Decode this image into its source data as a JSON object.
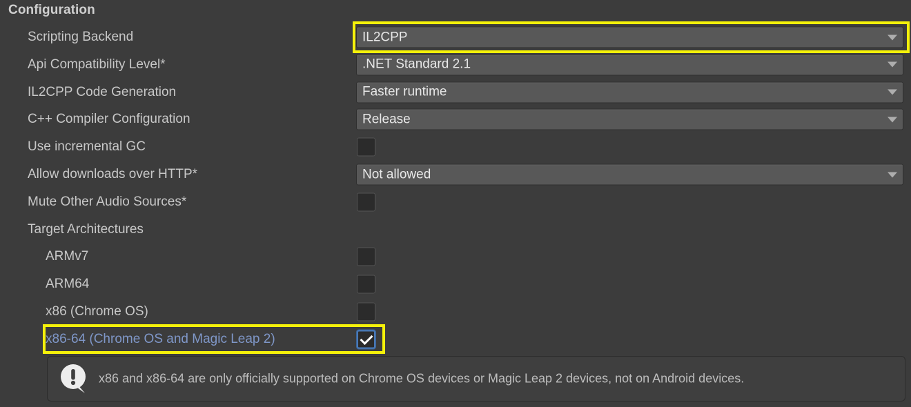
{
  "section": {
    "title": "Configuration"
  },
  "rows": [
    {
      "id": "scripting-backend",
      "label": "Scripting Backend",
      "control": "dropdown",
      "value": "IL2CPP",
      "highlighted": true
    },
    {
      "id": "api-compatibility-level",
      "label": "Api Compatibility Level*",
      "control": "dropdown",
      "value": ".NET Standard 2.1",
      "highlighted": false
    },
    {
      "id": "il2cpp-code-generation",
      "label": "IL2CPP Code Generation",
      "control": "dropdown",
      "value": "Faster runtime",
      "highlighted": false
    },
    {
      "id": "cpp-compiler-configuration",
      "label": "C++ Compiler Configuration",
      "control": "dropdown",
      "value": "Release",
      "highlighted": false
    },
    {
      "id": "use-incremental-gc",
      "label": "Use incremental GC",
      "control": "checkbox",
      "checked": false,
      "highlighted": false
    },
    {
      "id": "allow-downloads-over-http",
      "label": "Allow downloads over HTTP*",
      "control": "dropdown",
      "value": "Not allowed",
      "highlighted": false
    },
    {
      "id": "mute-other-audio-sources",
      "label": "Mute Other Audio Sources*",
      "control": "checkbox",
      "checked": false,
      "highlighted": false
    },
    {
      "id": "target-architectures",
      "label": "Target Architectures",
      "control": "none",
      "highlighted": false
    },
    {
      "id": "armv7",
      "label": "ARMv7",
      "control": "checkbox",
      "checked": false,
      "indent": 2,
      "highlighted": false
    },
    {
      "id": "arm64",
      "label": "ARM64",
      "control": "checkbox",
      "checked": false,
      "indent": 2,
      "highlighted": false
    },
    {
      "id": "x86-chrome-os",
      "label": "x86 (Chrome OS)",
      "control": "checkbox",
      "checked": false,
      "indent": 2,
      "highlighted": false
    },
    {
      "id": "x86-64-chrome-os-and-magic-leap-2",
      "label": "x86-64 (Chrome OS and Magic Leap 2)",
      "control": "checkbox",
      "checked": true,
      "indent": 2,
      "selected": true,
      "highlighted": true
    }
  ],
  "info": {
    "icon": "info-bubble-icon",
    "message": "x86 and x86-64 are only officially supported on Chrome OS devices or Magic Leap 2 devices, not on Android devices."
  },
  "colors": {
    "background": "#3c3c3c",
    "label": "#c8c8c8",
    "selected_label": "#7f97c8",
    "dropdown_background": "#585858",
    "highlight": "#f5f10a",
    "checkbox_accent": "#4a7ab8"
  }
}
